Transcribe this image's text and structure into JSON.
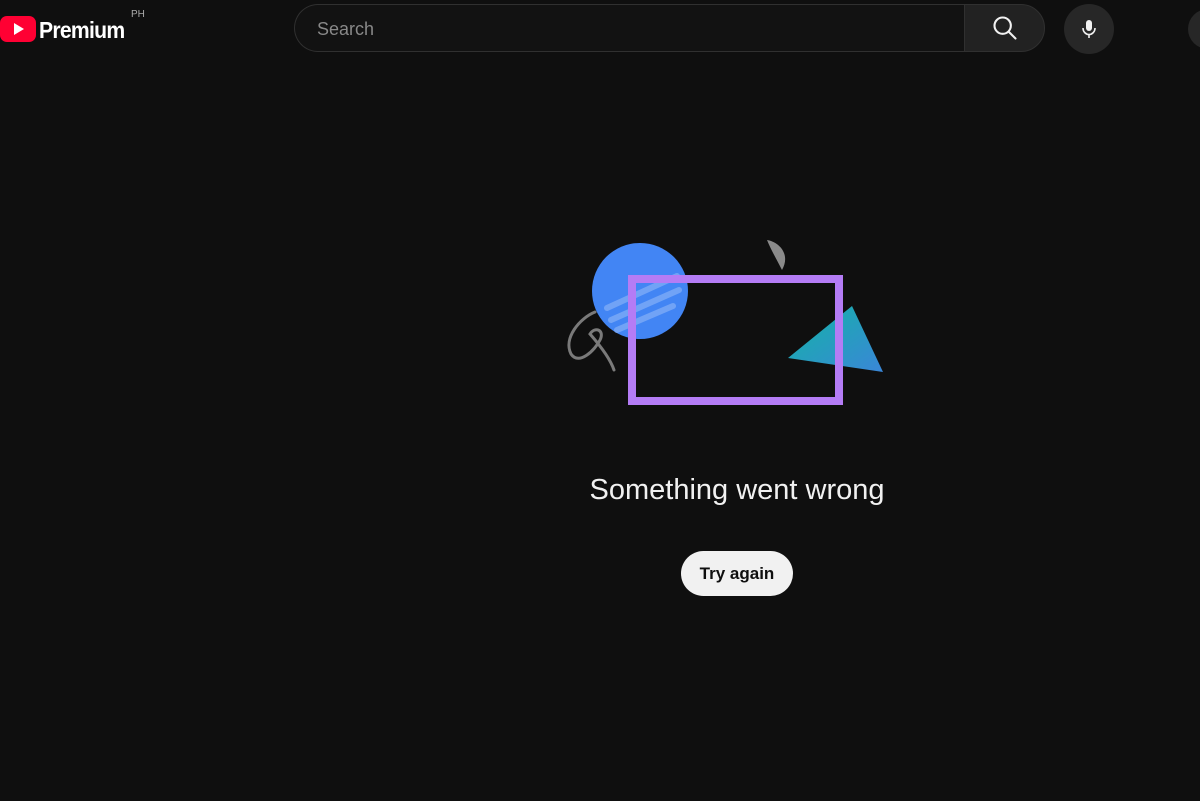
{
  "header": {
    "logo_text": "Premium",
    "country_code": "PH",
    "search": {
      "placeholder": "Search",
      "value": ""
    },
    "search_icon": "search-icon",
    "mic_icon": "microphone-icon"
  },
  "error": {
    "title": "Something went wrong",
    "retry_label": "Try again"
  },
  "colors": {
    "background": "#0f0f0f",
    "brand_red": "#ff0033",
    "illustration_frame": "#b47cf5",
    "illustration_circle": "#4285f4",
    "illustration_triangle": "#12b5a5",
    "button_bg": "#f1f1f1"
  }
}
